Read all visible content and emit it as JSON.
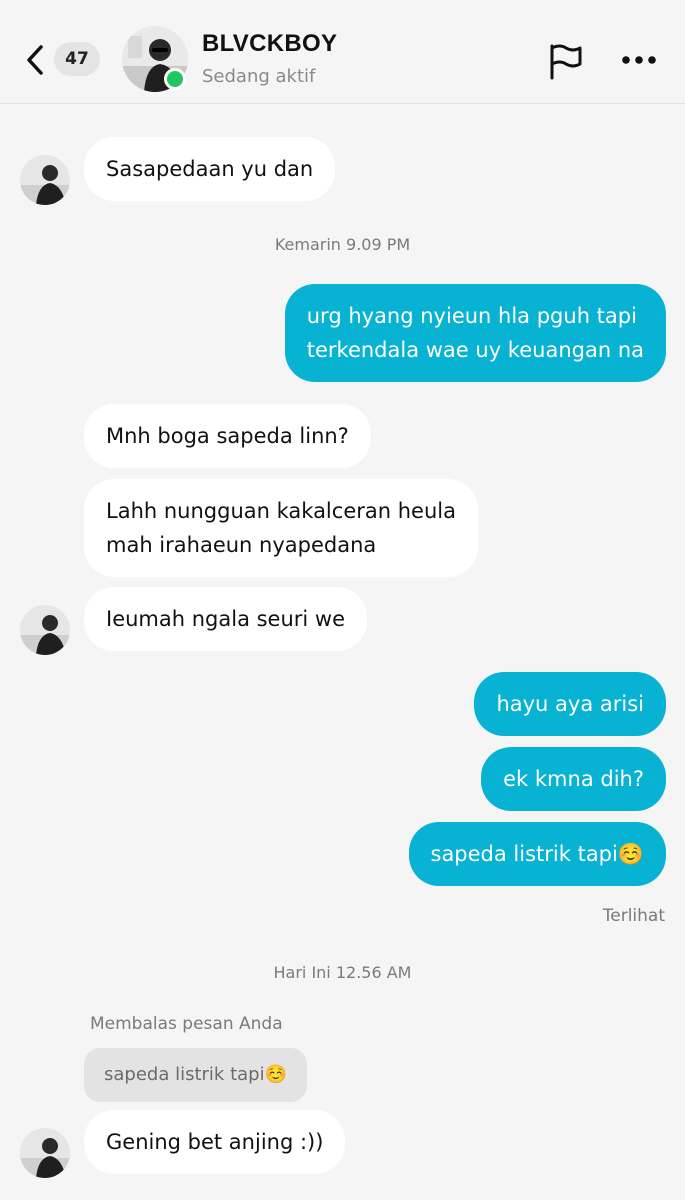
{
  "header": {
    "back_count": "47",
    "name": "BLVCKBOY",
    "status": "Sedang aktif",
    "accent": "#22c55e"
  },
  "messages": [
    {
      "text": "Sasapedaan yu dan"
    },
    {
      "timestamp": "Kemarin 9.09 PM"
    },
    {
      "text": "urg hyang nyieun hla pguh tapi\nterkendala wae uy keuangan na"
    },
    {
      "text": "Mnh boga sapeda linn?"
    },
    {
      "text": "Lahh nungguan kakalceran heula\nmah irahaeun nyapedana"
    },
    {
      "text": "Ieumah ngala seuri we"
    },
    {
      "text": "hayu aya arisi"
    },
    {
      "text": "ek kmna dih?"
    },
    {
      "text": "sapeda listrik tapi☺️"
    },
    {
      "seen": "Terlihat"
    },
    {
      "timestamp": "Hari Ini 12.56 AM"
    },
    {
      "reply_label": "Membalas pesan Anda",
      "quoted": "sapeda listrik tapi☺️"
    },
    {
      "text": "Gening bet anjing :))"
    }
  ],
  "colors": {
    "outgoing_bubble": "#08b2d3",
    "incoming_bubble": "#ffffff",
    "background": "#f5f5f5"
  }
}
